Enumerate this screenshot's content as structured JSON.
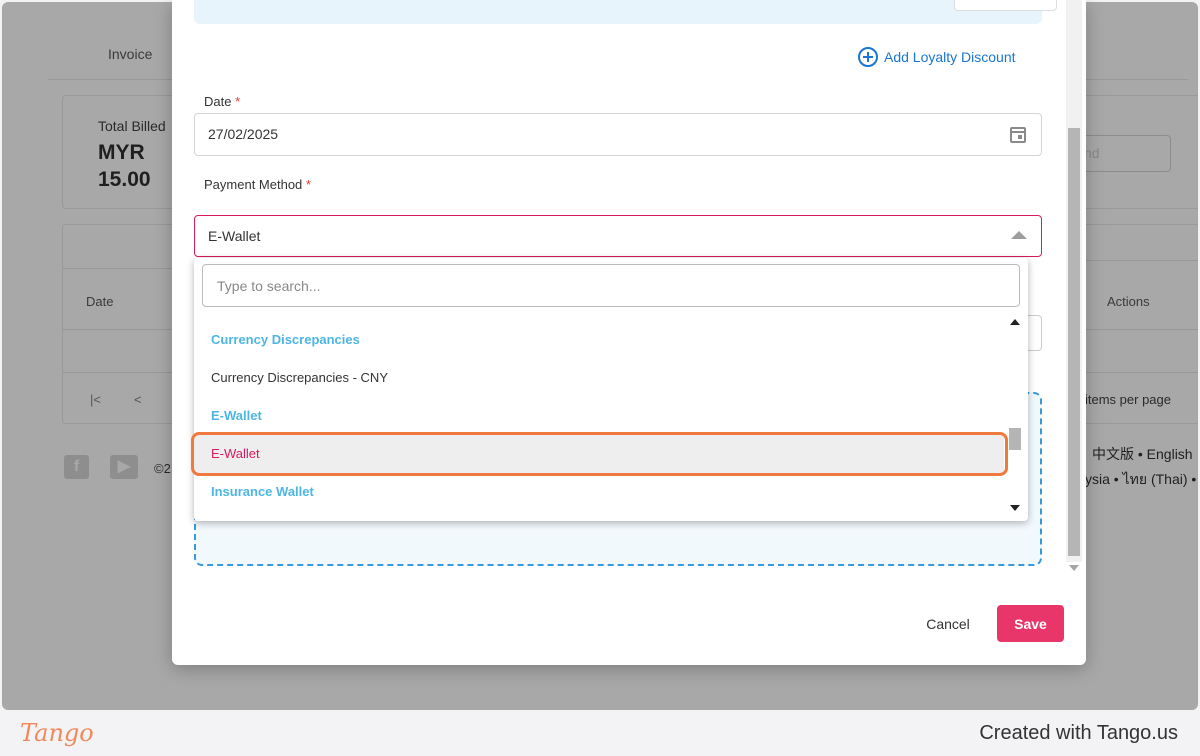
{
  "background": {
    "tab_invoice": "Invoice",
    "total_billed_label": "Total Billed",
    "total_billed_value": "MYR 15.00",
    "search_placeholder": "nd",
    "table_header_date": "Date",
    "table_header_actions": "Actions",
    "pager_first": "|<",
    "pager_prev": "<",
    "items_per_page": "items per page",
    "copyright": "©2",
    "language_line1": "中文版 • English",
    "language_line2": "ysia • ไทย (Thai) •"
  },
  "modal": {
    "add_loyalty_discount": "Add Loyalty Discount",
    "date_label": "Date",
    "date_required": "*",
    "date_value": "27/02/2025",
    "payment_method_label": "Payment Method",
    "payment_method_required": "*",
    "payment_method_value": "E-Wallet",
    "cancel_label": "Cancel",
    "save_label": "Save"
  },
  "dropdown": {
    "search_placeholder": "Type to search...",
    "items": [
      {
        "label": "Currency Discrepancies",
        "type": "group"
      },
      {
        "label": "Currency Discrepancies - CNY",
        "type": "option"
      },
      {
        "label": "E-Wallet",
        "type": "group"
      },
      {
        "label": "E-Wallet",
        "type": "option",
        "selected": true
      },
      {
        "label": "Insurance Wallet",
        "type": "group"
      }
    ]
  },
  "footer": {
    "logo": "Tango",
    "credit": "Created with Tango.us"
  },
  "colors": {
    "accent_pink": "#e8356a",
    "selected_text": "#d81b60",
    "group_header": "#4db6e5",
    "link_blue": "#1976d2",
    "highlight_orange": "#f07a3e"
  }
}
